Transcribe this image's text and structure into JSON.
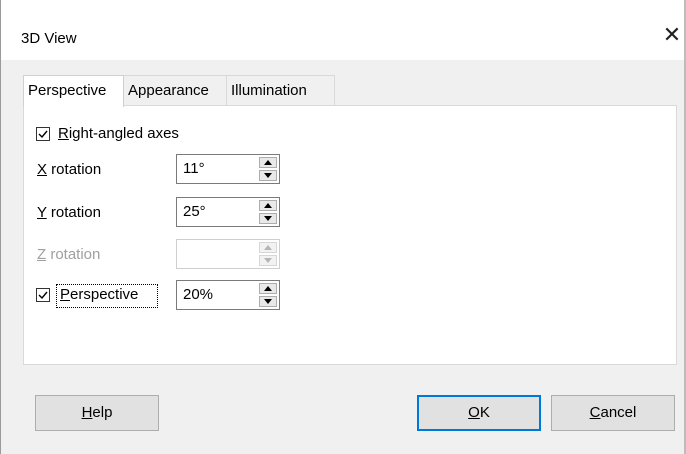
{
  "window": {
    "title": "3D View",
    "close_glyph": "✕"
  },
  "tabs": [
    {
      "label": "Perspective",
      "active": true
    },
    {
      "label": "Appearance",
      "active": false
    },
    {
      "label": "Illumination",
      "active": false
    }
  ],
  "perspective_tab": {
    "right_angled_axes": {
      "mnemonic": "R",
      "rest": "ight-angled axes",
      "checked": true
    },
    "x_rotation": {
      "mnemonic": "X",
      "rest": " rotation",
      "value": "11°"
    },
    "y_rotation": {
      "mnemonic": "Y",
      "rest": " rotation",
      "value": "25°"
    },
    "z_rotation": {
      "mnemonic": "Z",
      "rest": " rotation",
      "value": "",
      "disabled": true
    },
    "perspective": {
      "mnemonic": "P",
      "rest": "erspective",
      "checked": true,
      "value": "20%"
    }
  },
  "buttons": {
    "help": {
      "mnemonic": "H",
      "rest": "elp"
    },
    "ok": {
      "mnemonic": "O",
      "rest": "K"
    },
    "cancel": {
      "mnemonic": "C",
      "rest": "ancel"
    }
  },
  "colors": {
    "accent": "#0078d7",
    "dialog_bg": "#f0f0f0",
    "disabled_text": "#a0a0a0"
  }
}
